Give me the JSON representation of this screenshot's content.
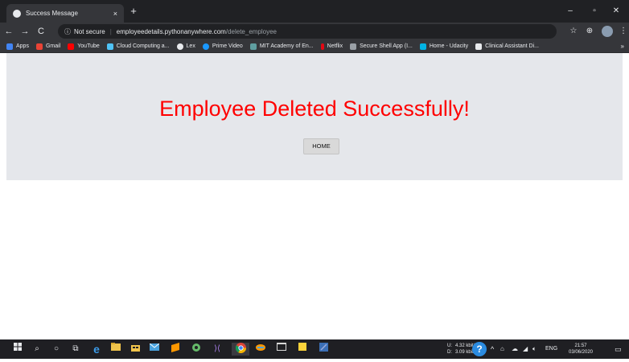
{
  "browser": {
    "tab_title": "Success Message",
    "tab_close": "×",
    "new_tab": "+",
    "window_controls": {
      "minimize": "–",
      "maximize": "▫",
      "close": "✕"
    },
    "nav": {
      "back": "←",
      "forward": "→",
      "reload": "C"
    },
    "address": {
      "security_icon": "ⓘ",
      "security_label": "Not secure",
      "separator": "|",
      "host": "employeedetails.pythonanywhere.com",
      "path": "/delete_employee"
    },
    "toolbar_icons": {
      "star": "☆",
      "extension": "⊕",
      "menu": "⋮"
    },
    "bookmarks": [
      {
        "label": "Apps",
        "color": "#4285f4"
      },
      {
        "label": "Gmail",
        "color": "#ea4335"
      },
      {
        "label": "YouTube",
        "color": "#ff0000"
      },
      {
        "label": "Cloud Computing a...",
        "color": "#4fc3f7"
      },
      {
        "label": "Lex",
        "color": "#e8eaed"
      },
      {
        "label": "Prime Video",
        "color": "#1a98ff"
      },
      {
        "label": "MIT Academy of En...",
        "color": "#5f9ea0"
      },
      {
        "label": "Netflix",
        "color": "#e50914"
      },
      {
        "label": "Secure Shell App (I...",
        "color": "#9aa0a6"
      },
      {
        "label": "Home - Udacity",
        "color": "#02b3e4"
      },
      {
        "label": "Clinical Assistant Di...",
        "color": "#e8eaed"
      }
    ],
    "bookmarks_more": "»"
  },
  "page": {
    "heading": "Employee Deleted Successfully!",
    "home_button": "HOME"
  },
  "taskbar": {
    "apps": [
      "windows",
      "search",
      "cortana",
      "task-view",
      "edge",
      "file-explorer",
      "store",
      "mail",
      "sublime",
      "atom",
      "vscode",
      "chrome",
      "sublime-alt",
      "terminal",
      "sticky-notes",
      "python"
    ],
    "network_up": "4.32 kbit/s",
    "network_down": "3.09 kbit/s",
    "net_label_up": "U:",
    "net_label_down": "D:",
    "help": "?",
    "tray": "^",
    "language": "ENG",
    "time": "21:57",
    "date": "03/06/2020"
  }
}
